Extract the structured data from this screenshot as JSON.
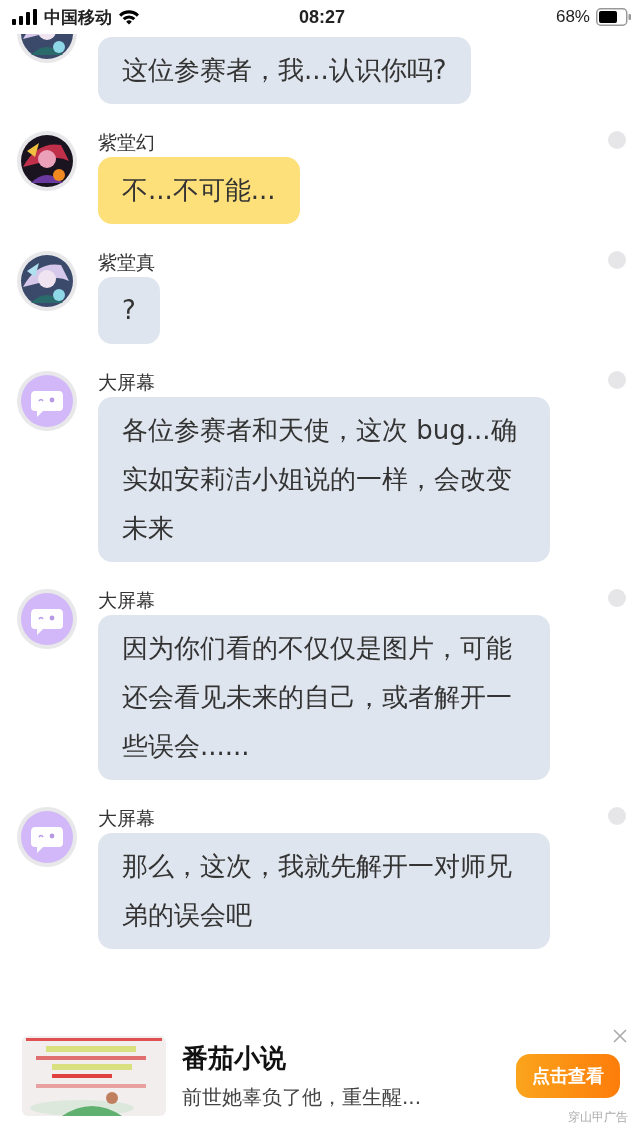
{
  "status_bar": {
    "carrier": "中国移动",
    "time": "08:27",
    "battery": "68%"
  },
  "messages": [
    {
      "text": "这位参赛者，我...认识你吗?",
      "color": "#dfe5ee"
    },
    {
      "sender": "紫堂幻",
      "text": "不...不可能...",
      "color": "#fde07a"
    },
    {
      "sender": "紫堂真",
      "text": "?",
      "color": "#dfe5ee"
    },
    {
      "sender": "大屏幕",
      "avatar": {
        "kind": "bot"
      },
      "text": "各位参赛者和天使，这次 bug...确实如安莉洁小姐说的一样，会改变未来",
      "color": "#dfe5ee"
    },
    {
      "sender": "大屏幕",
      "avatar": {
        "kind": "bot"
      },
      "text": "因为你们看的不仅仅是图片，可能还会看见未来的自己，或者解开一些误会......",
      "color": "#dfe5ee"
    },
    {
      "sender": "大屏幕",
      "avatar": {
        "kind": "bot"
      },
      "text": "那么，这次，我就先解开一对师兄弟的误会吧",
      "color": "#dfe5ee"
    }
  ],
  "ad": {
    "title": "番茄小说",
    "description": "前世她辜负了他，重生醒...",
    "button": "点击查看",
    "source": "穿山甲广告"
  }
}
